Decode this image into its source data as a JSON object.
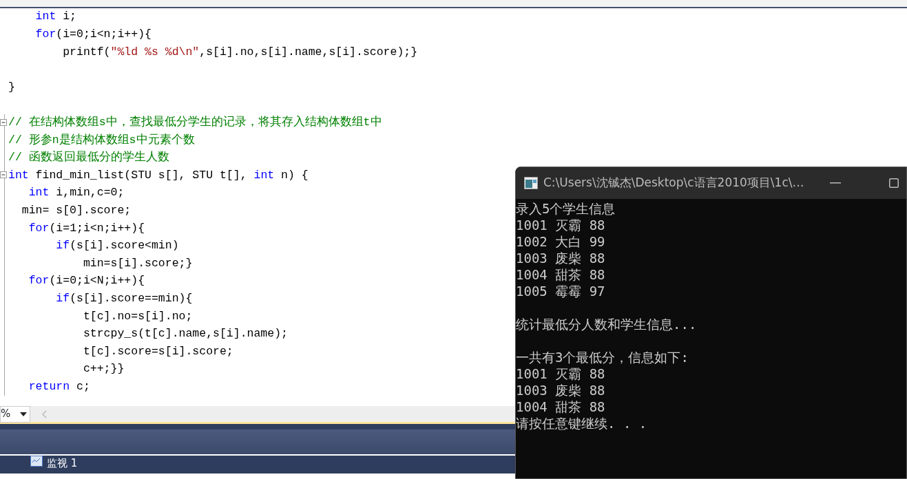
{
  "editor": {
    "lines": [
      {
        "fold": false,
        "segments": [
          {
            "kind": "keyword",
            "text": "    int"
          },
          {
            "kind": "text",
            "text": " i;"
          }
        ]
      },
      {
        "fold": false,
        "segments": [
          {
            "kind": "keyword",
            "text": "    for"
          },
          {
            "kind": "text",
            "text": "(i=0;i<n;i++){"
          }
        ]
      },
      {
        "fold": false,
        "segments": [
          {
            "kind": "text",
            "text": "        printf("
          },
          {
            "kind": "string",
            "text": "\"%ld %s %d\\n\""
          },
          {
            "kind": "text",
            "text": ",s[i].no,s[i].name,s[i].score);}"
          }
        ]
      },
      {
        "fold": false
      },
      {
        "fold": false,
        "segments": [
          {
            "kind": "text",
            "text": "}"
          }
        ]
      },
      {
        "fold": false
      },
      {
        "fold": true,
        "segments": [
          {
            "kind": "comment",
            "text": "// 在结构体数组s中，查找最低分学生的记录，将其存入结构体数组t中"
          }
        ]
      },
      {
        "fold": false,
        "segments": [
          {
            "kind": "comment",
            "text": "// 形参n是结构体数组s中元素个数"
          }
        ]
      },
      {
        "fold": false,
        "segments": [
          {
            "kind": "comment",
            "text": "// 函数返回最低分的学生人数"
          }
        ]
      },
      {
        "fold": true,
        "segments": [
          {
            "kind": "keyword",
            "text": "int"
          },
          {
            "kind": "text",
            "text": " find_min_list(STU s[], STU t[], "
          },
          {
            "kind": "keyword",
            "text": "int"
          },
          {
            "kind": "text",
            "text": " n) {"
          }
        ]
      },
      {
        "fold": false,
        "segments": [
          {
            "kind": "keyword",
            "text": "   int"
          },
          {
            "kind": "text",
            "text": " i,min,c=0;"
          }
        ]
      },
      {
        "fold": false,
        "segments": [
          {
            "kind": "text",
            "text": "  min= s[0].score;"
          }
        ]
      },
      {
        "fold": false,
        "segments": [
          {
            "kind": "keyword",
            "text": "   for"
          },
          {
            "kind": "text",
            "text": "(i=1;i<n;i++){"
          }
        ]
      },
      {
        "fold": false,
        "segments": [
          {
            "kind": "keyword",
            "text": "       if"
          },
          {
            "kind": "text",
            "text": "(s[i].score<min)"
          }
        ]
      },
      {
        "fold": false,
        "segments": [
          {
            "kind": "text",
            "text": "           min=s[i].score;}"
          }
        ]
      },
      {
        "fold": false,
        "segments": [
          {
            "kind": "keyword",
            "text": "   for"
          },
          {
            "kind": "text",
            "text": "(i=0;i<N;i++){"
          }
        ]
      },
      {
        "fold": false,
        "segments": [
          {
            "kind": "keyword",
            "text": "       if"
          },
          {
            "kind": "text",
            "text": "(s[i].score==min){"
          }
        ]
      },
      {
        "fold": false,
        "segments": [
          {
            "kind": "text",
            "text": "           t[c].no=s[i].no;"
          }
        ]
      },
      {
        "fold": false,
        "segments": [
          {
            "kind": "text",
            "text": "           strcpy_s(t[c].name,s[i].name);"
          }
        ]
      },
      {
        "fold": false,
        "segments": [
          {
            "kind": "text",
            "text": "           t[c].score=s[i].score;"
          }
        ]
      },
      {
        "fold": false,
        "segments": [
          {
            "kind": "text",
            "text": "           c++;}}"
          }
        ]
      },
      {
        "fold": false,
        "segments": [
          {
            "kind": "keyword",
            "text": "   return"
          },
          {
            "kind": "text",
            "text": " c;"
          }
        ]
      }
    ],
    "zoom": "%"
  },
  "bottom_panel": {
    "tabs": [
      {
        "label": "监视 1",
        "selected": false
      }
    ]
  },
  "console": {
    "title": "C:\\Users\\沈铖杰\\Desktop\\c语言2010项目\\1c\\…",
    "lines": [
      {
        "gap_before": false,
        "text": "录入5个学生信息"
      },
      {
        "gap_before": false,
        "text": "1001 灭霸 88"
      },
      {
        "gap_before": false,
        "text": "1002 大白 99"
      },
      {
        "gap_before": false,
        "text": "1003 废柴 88"
      },
      {
        "gap_before": false,
        "text": "1004 甜茶 88"
      },
      {
        "gap_before": false,
        "text": "1005 霉霉 97"
      },
      {
        "gap_before": true,
        "text": "统计最低分人数和学生信息..."
      },
      {
        "gap_before": true,
        "text": "一共有3个最低分，信息如下:"
      },
      {
        "gap_before": false,
        "text": "1001 灭霸 88"
      },
      {
        "gap_before": false,
        "text": "1003 废柴 88"
      },
      {
        "gap_before": false,
        "text": "1004 甜茶 88"
      },
      {
        "gap_before": false,
        "text": "请按任意键继续. . ."
      }
    ]
  }
}
